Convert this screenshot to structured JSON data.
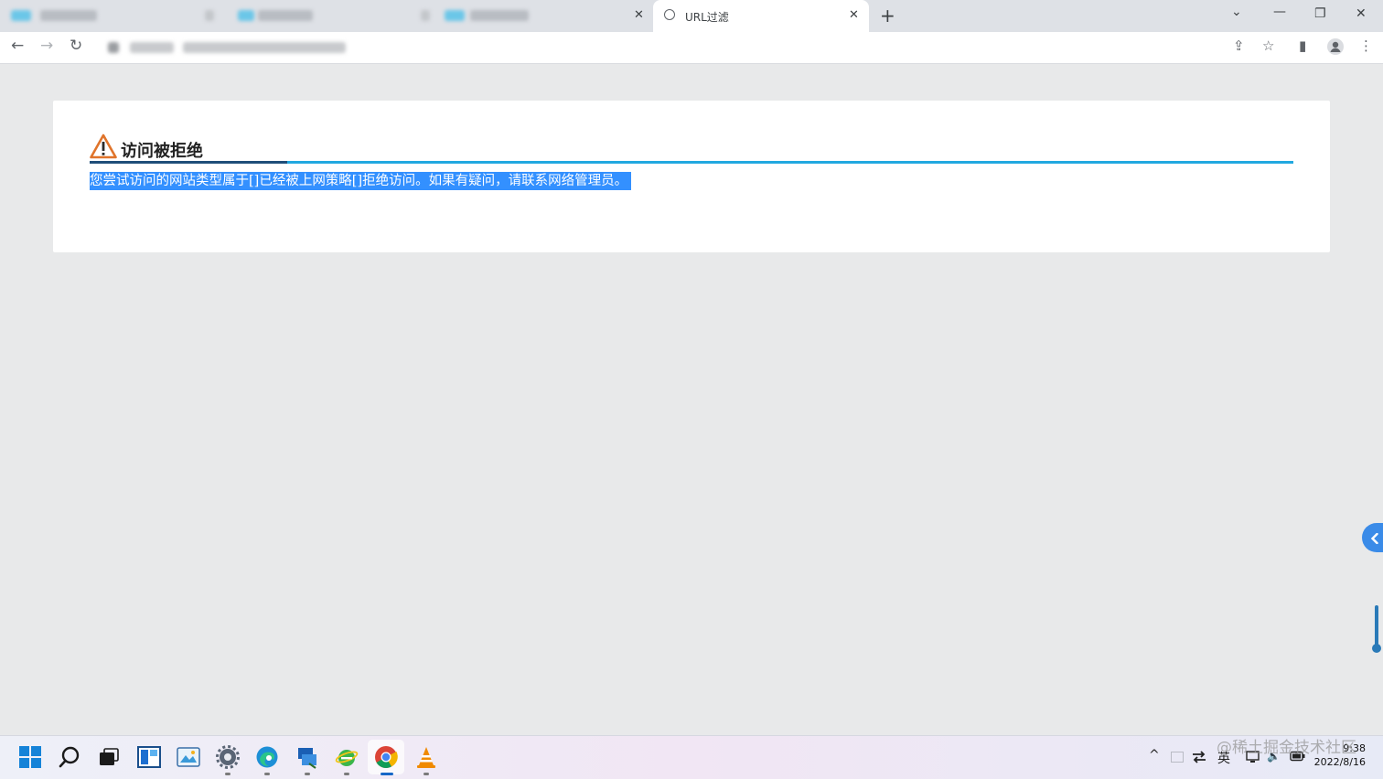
{
  "browser": {
    "active_tab_title": "URL过滤",
    "tab_close": "✕",
    "new_tab": "+",
    "window_controls": {
      "dropdown": "⌄",
      "minimize": "—",
      "restore": "❐",
      "close": "✕"
    },
    "nav": {
      "back": "←",
      "forward": "→",
      "reload": "↻"
    },
    "toolbar_icons": {
      "share": "⇪",
      "bookmark": "☆",
      "sidepanel": "▮",
      "profile": "●",
      "menu": "⋮"
    }
  },
  "page": {
    "title": "访问被拒绝",
    "message": "您尝试访问的网站类型属于[]已经被上网策略[]拒绝访问。如果有疑问，请联系网络管理员。",
    "colors": {
      "title_underline_dark": "#1f4e79",
      "title_underline_light": "#21a8e0",
      "selection": "#3390ff",
      "warning": "#e0742b"
    }
  },
  "side_button": {
    "icon": "chevron-left"
  },
  "taskbar": {
    "apps": [
      "start",
      "search",
      "task-view",
      "widgets",
      "photos",
      "settings",
      "edge",
      "remote-desktop",
      "ie",
      "chrome",
      "vlc"
    ],
    "tray": {
      "chevron": "^",
      "ime": "英",
      "volume": "🔈"
    },
    "clock_time": "9:38",
    "clock_date": "2022/8/16"
  },
  "watermark": "@稀土掘金技术社区"
}
